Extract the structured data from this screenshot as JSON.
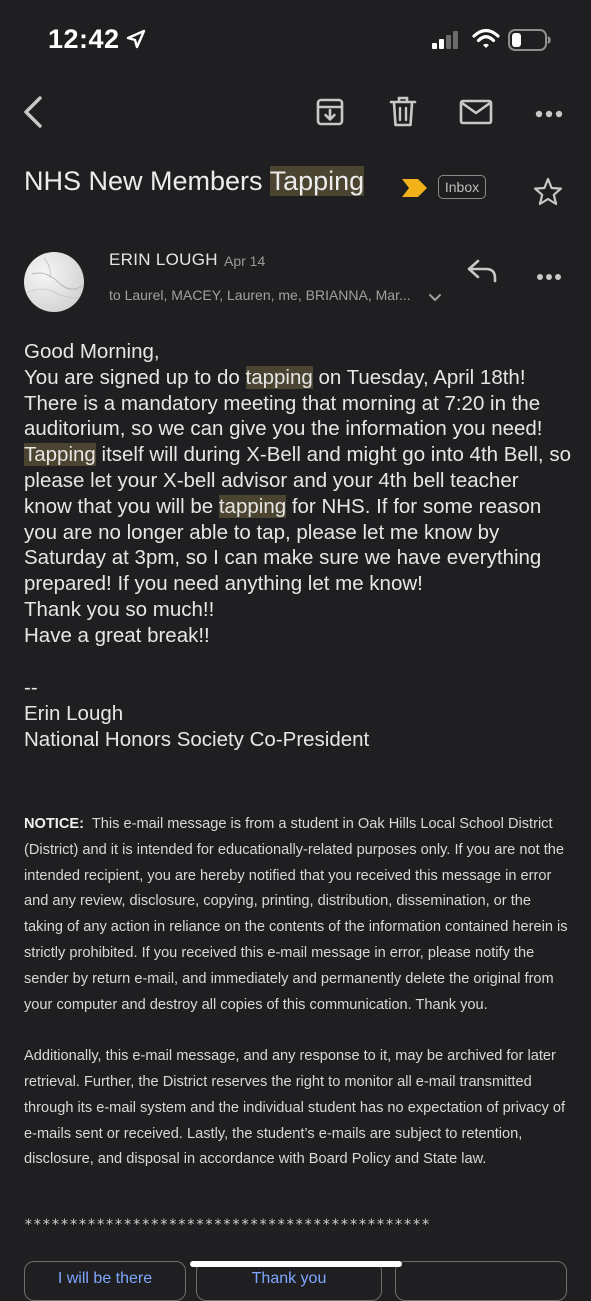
{
  "status_bar": {
    "time": "12:42"
  },
  "toolbar": {
    "back_icon": "chevron-left-icon",
    "archive_icon": "archive-icon",
    "delete_icon": "trash-icon",
    "mark_unread_icon": "mail-icon",
    "more_icon": "more-horizontal-icon"
  },
  "subject": {
    "text_before": "NHS New Members ",
    "highlight": "Tapping",
    "label": "Inbox"
  },
  "message": {
    "sender": "ERIN LOUGH",
    "date": "Apr 14",
    "recipients": "to Laurel, MACEY, Lauren, me, BRIANNA, Mar...",
    "greeting": "Good Morning,",
    "body": {
      "s1": "You are signed up to do ",
      "h1": "tapping",
      "s2": " on Tuesday, April 18th! There is a mandatory meeting that morning at 7:20 in the auditorium, so we can give you the information you need! ",
      "h2": "Tapping",
      "s3": " itself will during X-Bell and might go into 4th Bell, so please let your X-bell advisor and your 4th bell teacher know that you will be ",
      "h3": "tapping",
      "s4": " for NHS. If for some reason you are no longer able to tap, please let me know by Saturday at 3pm, so I can make sure we have everything prepared! If you need anything let me know!"
    },
    "thanks": "Thank you so much!!",
    "closing": "Have a great break!!",
    "sig_dash": "--",
    "sig_name": "Erin Lough",
    "sig_title": "National Honors Society Co-President",
    "notice_label": "NOTICE:",
    "notice_text": "This e-mail message is from a student in Oak Hills Local School District (District) and it is intended for educationally-related purposes only. If you are not the intended recipient, you are hereby notified that you received this message in error and any review, disclosure, copying, printing, distribution, dissemination, or the taking of any action in reliance on the contents of the information contained herein is strictly prohibited.  If you received this e-mail message in error, please notify the sender by return e-mail, and immediately and permanently delete the original from your computer and destroy all copies of this communication.  Thank you.",
    "additional_text": "Additionally, this e-mail message, and any response to it, may be archived for later retrieval.  Further, the District reserves the right to monitor all e-mail transmitted through its e-mail system and the individual student has no expectation of privacy of e-mails sent or received.  Lastly, the student’s e-mails are subject to retention, disclosure, and disposal in accordance with Board Policy and State law.",
    "stars": "*********************************************"
  },
  "quick_replies": [
    "I will be there",
    "Thank you"
  ],
  "colors": {
    "background": "#1f1f21",
    "highlight": "#4a4430",
    "important": "#f2b21a",
    "link": "#7fa6ff"
  }
}
